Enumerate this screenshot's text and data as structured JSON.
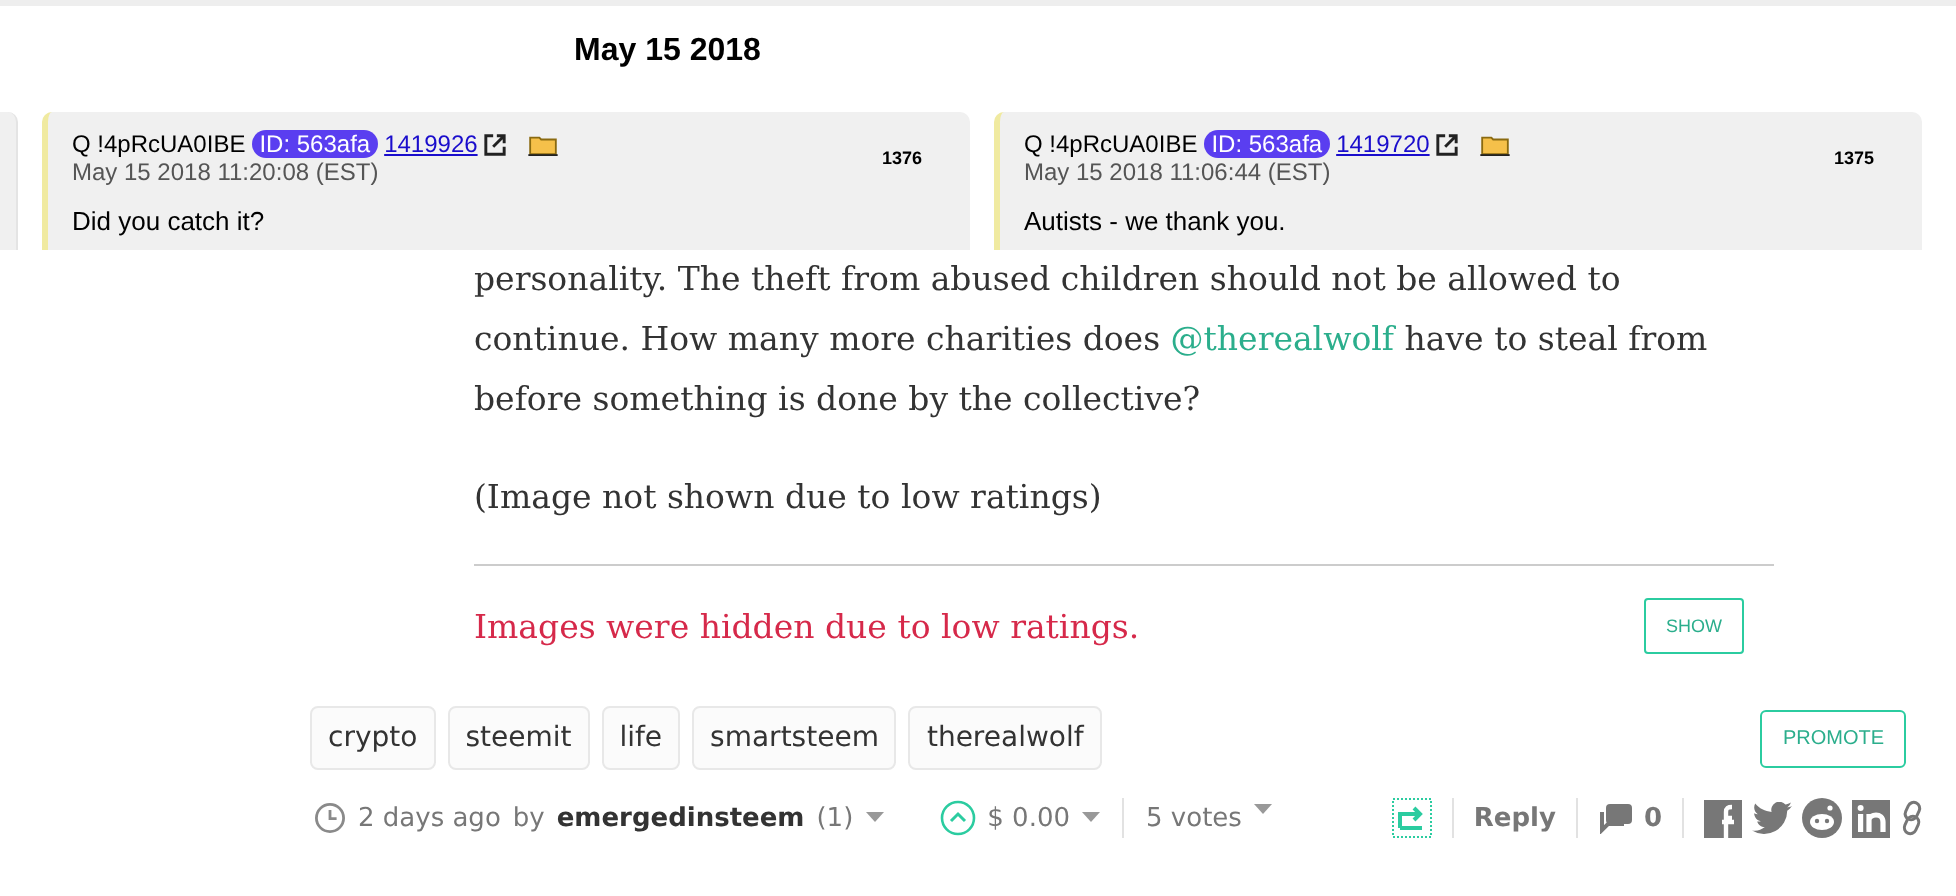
{
  "date_header": "May 15 2018",
  "posts": [
    {
      "author": "Q !4pRcUA0IBE",
      "id_badge": "ID: 563afa",
      "post_link": "1419926",
      "timestamp": "May 15 2018 11:20:08 (EST)",
      "number": "1376",
      "message": "Did you catch it?"
    },
    {
      "author": "Q !4pRcUA0IBE",
      "id_badge": "ID: 563afa",
      "post_link": "1419720",
      "timestamp": "May 15 2018 11:06:44 (EST)",
      "number": "1375",
      "message": "Autists - we thank you."
    }
  ],
  "article": {
    "paragraph_parts": [
      "personality. The theft from abused children should not be allowed to continue. How many more charities does ",
      "@therealwolf",
      " have to steal from before something is done by the collective?"
    ],
    "image_note": "(Image not shown due to low ratings)",
    "hidden_notice": "Images were hidden due to low ratings.",
    "show_button": "SHOW"
  },
  "tags": [
    "crypto",
    "steemit",
    "life",
    "smartsteem",
    "therealwolf"
  ],
  "promote_button": "PROMOTE",
  "footer": {
    "age": "2 days ago",
    "by": "by",
    "author": "emergedinsteem",
    "reputation": "(1)",
    "payout": "$ 0.00",
    "votes": "5 votes",
    "resteemed": true,
    "reply": "Reply",
    "comments": "0"
  }
}
